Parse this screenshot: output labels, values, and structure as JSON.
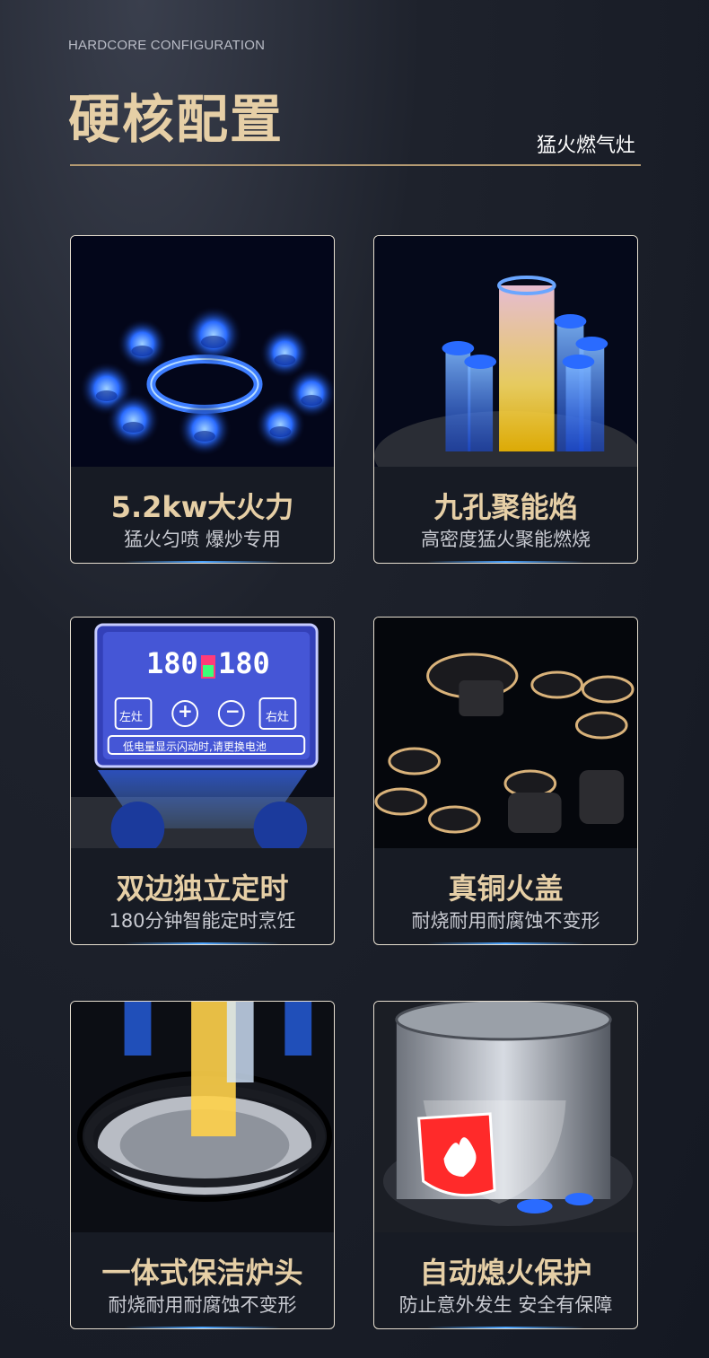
{
  "header": {
    "eyebrow": "HARDCORE CONFIGURATION",
    "title": "硬核配置",
    "subtitle": "猛火燃气灶"
  },
  "cards": [
    {
      "title": "5.2kw大火力",
      "subtitle": "猛火匀喷 爆炒专用",
      "image": "blue-flame-burner-ring"
    },
    {
      "title": "九孔聚能焰",
      "subtitle": "高密度猛火聚能燃烧",
      "image": "nine-hole-flame-columns"
    },
    {
      "title": "双边独立定时",
      "subtitle": "180分钟智能定时烹饪",
      "image": "timer-control-panel"
    },
    {
      "title": "真铜火盖",
      "subtitle": "耐烧耐用耐腐蚀不变形",
      "image": "copper-burner-caps"
    },
    {
      "title": "一体式保洁炉头",
      "subtitle": "耐烧耐用耐腐蚀不变形",
      "image": "integrated-burner-head"
    },
    {
      "title": "自动熄火保护",
      "subtitle": "防止意外发生 安全有保障",
      "image": "flame-safety-pot"
    }
  ],
  "timer_panel": {
    "left_time": "180",
    "right_time": "180",
    "left_button": "左灶",
    "right_button": "右灶",
    "plus": "+",
    "minus": "−",
    "warning": "低电量显示闪动时,请更换电池"
  },
  "colors": {
    "gold": "#e6cfa6",
    "accent_blue": "#2a6bff",
    "background": "#1a1e28"
  }
}
